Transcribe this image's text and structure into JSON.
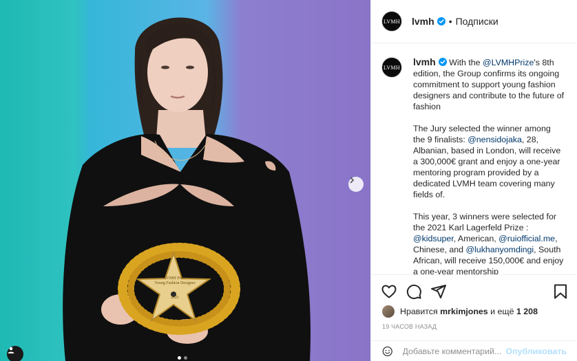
{
  "post": {
    "username": "lvmh",
    "avatar_text": "LVMH",
    "follow_separator": "•",
    "follow_label": "Подписки",
    "trophy_lines": [
      "LVMH Prize",
      "Young Fashion Designer",
      "2021"
    ]
  },
  "caption": {
    "username": "lvmh",
    "p1_before": " With the ",
    "p1_mention": "@LVMHPrize",
    "p1_after": "'s 8th edition, the Group confirms its ongoing commitment to support young fashion designers and contribute to the future of fashion",
    "p2_before": "The Jury selected the winner among the 9 finalists: ",
    "p2_mention": "@nensidojaka",
    "p2_after": ", 28, Albanian, based in London, will receive a 300,000€ grant and enjoy a one-year mentoring program provided by a dedicated LVMH team covering many fields of.",
    "p3_before": "This year, 3 winners were selected for the 2021 Karl Lagerfeld Prize : ",
    "p3_m1": "@kidsuper",
    "p3_t1": ", American, ",
    "p3_m2": "@ruiofficial.me",
    "p3_t2": ", Chinese, and ",
    "p3_m3": "@lukhanyomdingi",
    "p3_t3": ", South African, will receive 150,000€ and enjoy a one-year mentorship"
  },
  "likes": {
    "prefix": "Нравится",
    "user": "mrkimjones",
    "middle": "и ещё",
    "count": "1 208"
  },
  "timestamp": "19 ЧАСОВ НАЗАД",
  "comment": {
    "placeholder": "Добавьте комментарий...",
    "publish_label": "Опубликовать"
  },
  "icons": [
    "heart-icon",
    "comment-icon",
    "share-icon",
    "bookmark-icon",
    "emoji-icon",
    "verified-badge-icon",
    "chevron-right-icon",
    "user-tag-icon"
  ],
  "colors": {
    "verified": "#0095f6",
    "mention": "#00376b",
    "publish": "#b2dffc",
    "muted": "#8e8e8e"
  }
}
